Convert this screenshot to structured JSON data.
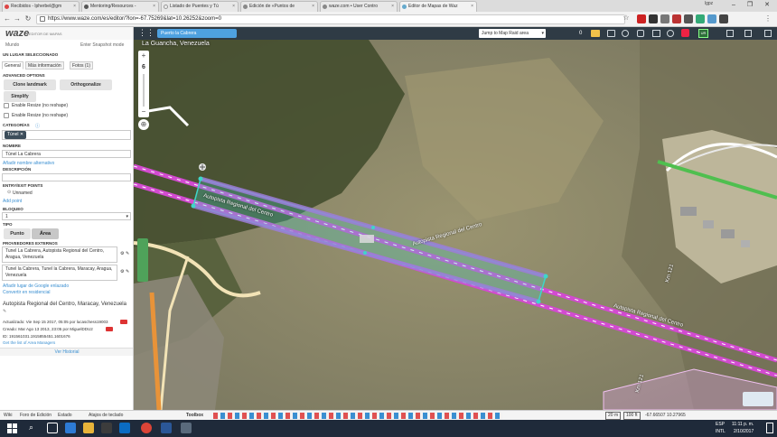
{
  "browser": {
    "tabs": [
      {
        "label": "Recibidos - lpherbel@gm"
      },
      {
        "label": "Mentoring/Resources -"
      },
      {
        "label": "Listado de Puentes y Tú"
      },
      {
        "label": "Edición de «Puntos de"
      },
      {
        "label": "waze.com • User Contro"
      },
      {
        "label": "Editor de Mapas de Waz"
      }
    ],
    "url": "https://www.waze.com/es/editor/?lon=-67.75269&lat=10.26252&zoom=0",
    "profile": "lgpz"
  },
  "sidebar": {
    "brand": "waze",
    "brand_sub": "EDITOR DE MAPAS",
    "world": "Mundo",
    "snapshot": "Enter Snapshot mode",
    "selected_header": "UN LUGAR SELECCIONADO",
    "tabs": [
      "General",
      "Más información",
      "Fotos (1)"
    ],
    "advanced_options": "ADVANCED OPTIONS",
    "clone_landmark": "Clone landmark",
    "orthogonalize": "Orthogonalize",
    "simplify": "Simplify",
    "enable_resize_1": "Enable Resize (no reshape)",
    "enable_resize_2": "Enable Resize (no reshape)",
    "categories_header": "CATEGORÍAS",
    "category_chip": "Túnel",
    "name_header": "NOMBRE",
    "name_value": "Túnel La Cabrera",
    "alt_name_link": "Añadir nombre alternativo",
    "description_header": "DESCRIPCIÓN",
    "entry_points_header": "ENTRY/EXIT POINTS",
    "unnamed": "Unnamed",
    "add_point": "Add point",
    "lock_header": "BLOQUEO",
    "lock_value": "1",
    "type_header": "TIPO",
    "type_point": "Punto",
    "type_area": "Área",
    "providers_header": "PROVEEDORES EXTERNOS",
    "provider_1": "Tunel La Cabrera, Autopista Regional del Centro, Aragua, Venezuela",
    "provider_2": "Tunel la Cabrera, Tunel la Cabrera, Maracay, Aragua, Venezuela",
    "add_google_link": "Añadir lugar de Google enlazado",
    "convert_link": "Convertir en residencial",
    "address": "Autopista Regional del Centro, Maracay, Venezuela",
    "updated": "Actualizado: Vie Sep 15 2017, 05:05 por lucaschess19003",
    "created": "Creado: Mar Ago 13 2013, 23:05 por MiguelDDU2",
    "id": "ID: 191561031.1915855451.1601676",
    "area_managers": "Get the list of Area Managers",
    "history": "Ver Historial"
  },
  "mapbar": {
    "location_chip": "Puerto la Cabrera",
    "jump_select": "Jump to Map Raid area",
    "counter": "0"
  },
  "map": {
    "place_label": "La Guancha, Venezuela",
    "zoom_level": "6",
    "road_label_1": "Autopista Regional del Centro",
    "road_label_2": "Autopista Regional del Centro",
    "road_label_3": "Autopista Regional del Centro",
    "km_label_1": "Km 121",
    "km_label_2": "Km 121",
    "scale_1": "20 m",
    "scale_2": "100 ft",
    "coords": "-67.66507 10.27965"
  },
  "bottombar": {
    "wiki": "Wiki",
    "forum": "Foro de Edición",
    "status": "Estado",
    "shortcuts": "Atajos de teclado",
    "toolbox": "Toolbox"
  },
  "taskbar": {
    "lang": "ESP",
    "lang2": "INTL",
    "time": "11:11 p. m.",
    "date": "2/10/2017"
  },
  "colors": {
    "highway": "#d24bd0",
    "tunnel_area": "#3fd6c8",
    "accent": "#3a8fd1",
    "sidebar_chip": "#3c4d5a"
  }
}
